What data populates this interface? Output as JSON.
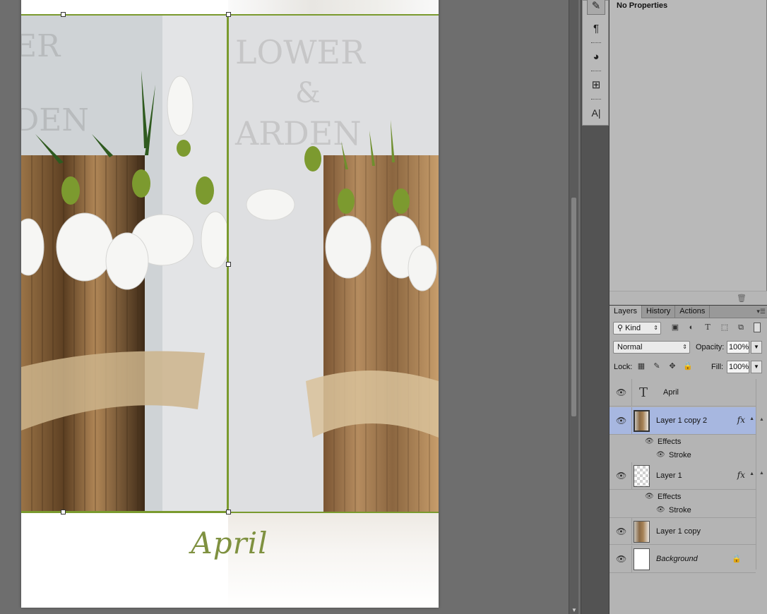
{
  "document": {
    "caption": "April"
  },
  "tool_strip": {
    "tools": [
      {
        "icon": "brush-presets-icon",
        "glyph": "✎"
      },
      {
        "icon": "paragraph-icon",
        "glyph": "¶"
      },
      {
        "icon": "adjustments-icon",
        "glyph": "◕"
      },
      {
        "icon": "layer-comps-icon",
        "glyph": "⊞"
      },
      {
        "icon": "character-icon",
        "glyph": "A|"
      }
    ]
  },
  "properties": {
    "title": "No Properties"
  },
  "layers_panel": {
    "tabs": [
      {
        "label": "Layers",
        "active": true
      },
      {
        "label": "History",
        "active": false
      },
      {
        "label": "Actions",
        "active": false
      }
    ],
    "filter": {
      "label": "Kind"
    },
    "blend_mode": "Normal",
    "opacity_label": "Opacity:",
    "opacity_value": "100%",
    "lock_label": "Lock:",
    "fill_label": "Fill:",
    "fill_value": "100%",
    "layers": [
      {
        "name": "April",
        "kind": "type",
        "selected": false
      },
      {
        "name": "Layer 1 copy 2",
        "kind": "photo",
        "selected": true,
        "fx": "fx",
        "effects_label": "Effects",
        "effect": "Stroke"
      },
      {
        "name": "Layer 1",
        "kind": "checker",
        "selected": false,
        "fx": "fx",
        "effects_label": "Effects",
        "effect": "Stroke"
      },
      {
        "name": "Layer 1 copy",
        "kind": "photo",
        "selected": false
      },
      {
        "name": "Background",
        "kind": "white",
        "selected": false,
        "locked": true
      }
    ]
  },
  "colors": {
    "selection_stroke": "#7a9a2e",
    "caption_green": "#7f9140",
    "selected_layer": "#a7b7e0"
  }
}
